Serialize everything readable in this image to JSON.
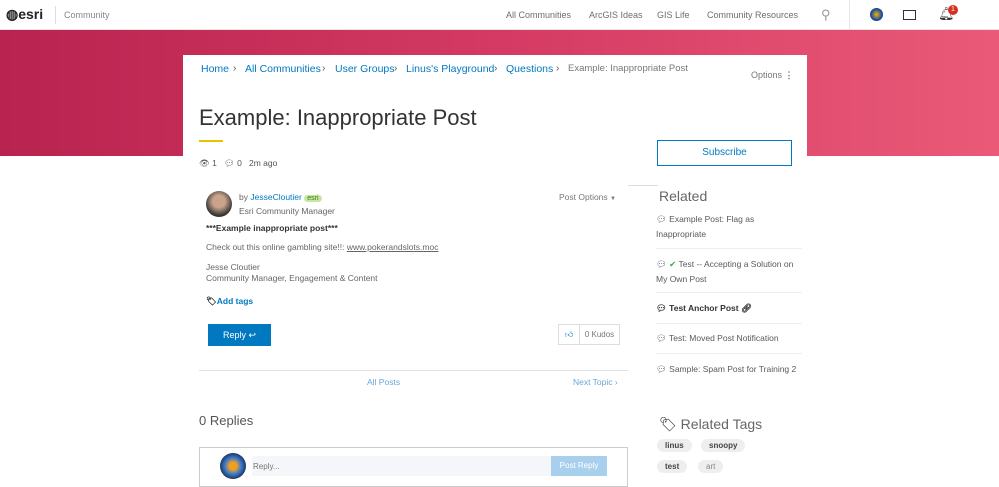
{
  "header": {
    "logo": "esri",
    "community": "Community",
    "nav": [
      "All Communities",
      "ArcGIS Ideas",
      "GIS Life",
      "Community Resources"
    ],
    "notification_count": "1"
  },
  "breadcrumb": [
    "Home",
    "All Communities",
    "User Groups",
    "Linus's Playground",
    "Questions",
    "Example: Inappropriate Post"
  ],
  "options_label": "Options",
  "title": "Example: Inappropriate Post",
  "meta": {
    "views": "1",
    "comments": "0",
    "time": "2m ago"
  },
  "subscribe": "Subscribe",
  "post": {
    "by": "by",
    "author": "JesseCloutier",
    "badge": "esri",
    "role": "Esri Community Manager",
    "options": "Post Options",
    "heading": "***Example inappropriate post***",
    "body": "Check out this online gambling site!!:",
    "link": "www.pokerandslots.moc",
    "sig_name": "Jesse Cloutier",
    "sig_title": "Community Manager, Engagement & Content",
    "add_tags": "Add tags",
    "reply": "Reply",
    "kudos": "0 Kudos"
  },
  "pager": {
    "all_posts": "All Posts",
    "next": "Next Topic"
  },
  "replies": {
    "heading": "0 Replies",
    "placeholder": "Reply...",
    "post_reply": "Post Reply"
  },
  "related": {
    "heading": "Related",
    "items": [
      "Example Post: Flag as Inappropriate",
      "Test -- Accepting a Solution on My Own Post",
      "Test Anchor Post",
      "Test: Moved Post Notification",
      "Sample: Spam Post for Training 2"
    ]
  },
  "related_tags": {
    "heading": "Related Tags",
    "tags": [
      "linus",
      "snoopy",
      "test",
      "art"
    ]
  }
}
